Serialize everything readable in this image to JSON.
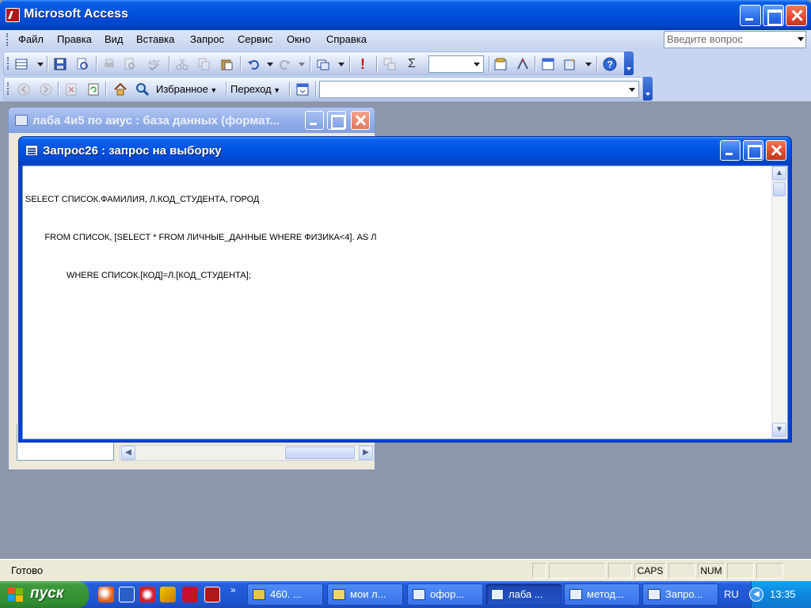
{
  "app": {
    "title": "Microsoft Access"
  },
  "menu": {
    "items": [
      "Файл",
      "Правка",
      "Вид",
      "Вставка",
      "Запрос",
      "Сервис",
      "Окно",
      "Справка"
    ],
    "ask_placeholder": "Введите вопрос"
  },
  "toolbar2": {
    "favorites_label": "Избранное",
    "goto_label": "Переход"
  },
  "db_window": {
    "title": "лаба 4и5 по аиус : база данных (формат..."
  },
  "query_window": {
    "title": "Запрос26 : запрос на выборку",
    "sql_lines": [
      "SELECT СПИСОК.ФАМИЛИЯ, Л.КОД_СТУДЕНТА, ГОРОД",
      "        FROM СПИСОК, [SELECT * FROM ЛИЧНЫЕ_ДАННЫЕ WHERE ФИЗИКА<4]. AS Л",
      "                 WHERE СПИСОК.[КОД]=Л.[КОД_СТУДЕНТА];"
    ]
  },
  "status": {
    "text": "Готово",
    "caps": "CAPS",
    "num": "NUM"
  },
  "taskbar": {
    "start_label": "пуск",
    "buttons": [
      "460. ...",
      "мои л...",
      "офор...",
      "лаба ...",
      "метод...",
      "Запро..."
    ],
    "lang": "RU",
    "clock": "13:35"
  }
}
